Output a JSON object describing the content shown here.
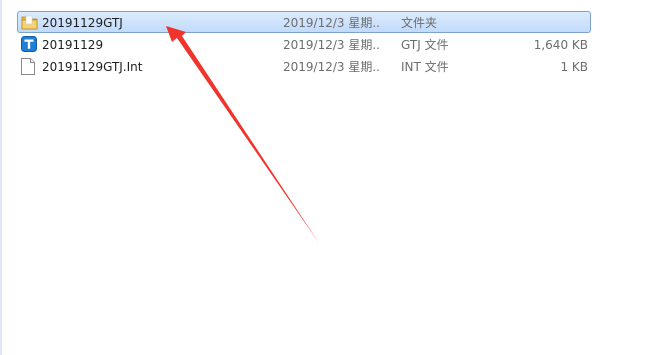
{
  "files": [
    {
      "name": "20191129GTJ",
      "date": "2019/12/3 星期...",
      "type": "文件夹",
      "size": "",
      "icon": "folder-icon",
      "selected": true
    },
    {
      "name": "20191129",
      "date": "2019/12/3 星期...",
      "type": "GTJ 文件",
      "size": "1,640 KB",
      "icon": "gtj-app-icon",
      "selected": false
    },
    {
      "name": "20191129GTJ.Int",
      "date": "2019/12/3 星期...",
      "type": "INT 文件",
      "size": "1 KB",
      "icon": "document-icon",
      "selected": false
    }
  ],
  "colors": {
    "selection_fill": "#cce0fa",
    "selection_border": "#7da2ce",
    "annotation_arrow": "#f0332b",
    "folder": "#e8c25a",
    "app_icon": "#1f7fd6"
  }
}
